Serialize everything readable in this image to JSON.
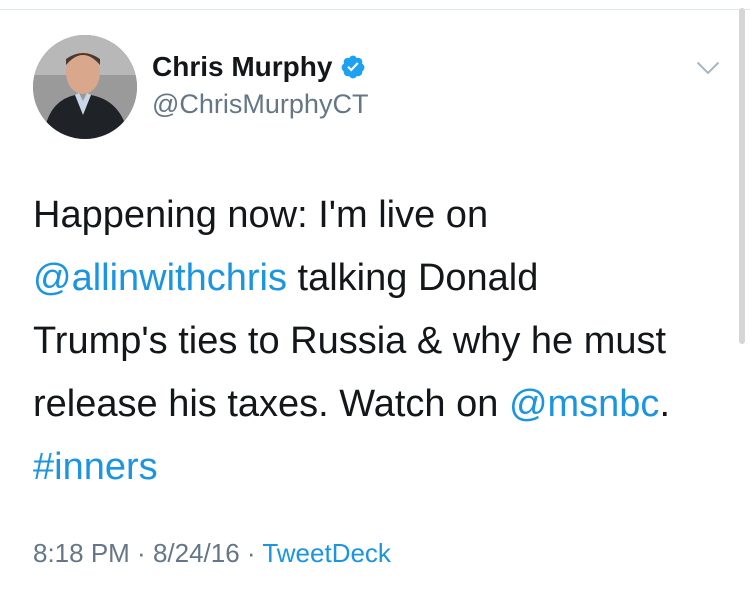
{
  "author": {
    "display_name": "Chris Murphy",
    "handle": "@ChrisMurphyCT",
    "verified": true,
    "verified_icon": "verified-badge-icon"
  },
  "tweet": {
    "lines": [
      [
        {
          "text": "Happening now: I'm live on",
          "link": false
        }
      ],
      [
        {
          "text": "@allinwithchris",
          "link": true
        },
        {
          "text": " talking Donald",
          "link": false
        }
      ],
      [
        {
          "text": "Trump's ties to Russia & why he must",
          "link": false
        }
      ],
      [
        {
          "text": "release his taxes. Watch on ",
          "link": false
        },
        {
          "text": "@msnbc",
          "link": true
        },
        {
          "text": ".",
          "link": false
        }
      ],
      [
        {
          "text": "#inners",
          "link": true
        }
      ]
    ]
  },
  "meta": {
    "time": "8:18 PM",
    "separator": " · ",
    "date": "8/24/16",
    "source": "TweetDeck"
  },
  "colors": {
    "link": "#1b95e0",
    "secondary_text": "#657786",
    "primary_text": "#14171a",
    "verified": "#1da1f2"
  },
  "icons": {
    "menu": "chevron-down-icon"
  }
}
